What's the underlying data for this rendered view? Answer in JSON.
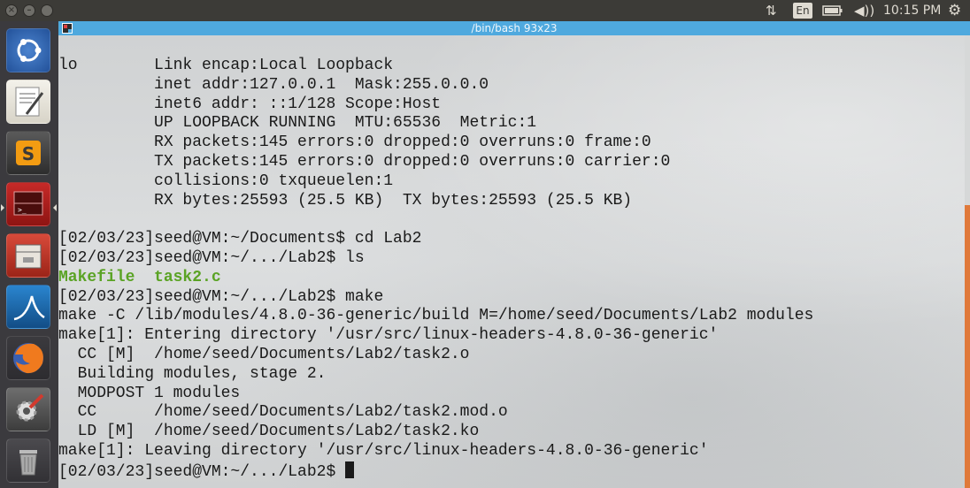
{
  "panel": {
    "clock": "10:15 PM",
    "language": "En"
  },
  "terminal": {
    "title": "/bin/bash 93x23",
    "lines": [
      "",
      "lo        Link encap:Local Loopback",
      "          inet addr:127.0.0.1  Mask:255.0.0.0",
      "          inet6 addr: ::1/128 Scope:Host",
      "          UP LOOPBACK RUNNING  MTU:65536  Metric:1",
      "          RX packets:145 errors:0 dropped:0 overruns:0 frame:0",
      "          TX packets:145 errors:0 dropped:0 overruns:0 carrier:0",
      "          collisions:0 txqueuelen:1",
      "          RX bytes:25593 (25.5 KB)  TX bytes:25593 (25.5 KB)",
      "",
      "[02/03/23]seed@VM:~/Documents$ cd Lab2",
      "[02/03/23]seed@VM:~/.../Lab2$ ls"
    ],
    "ls_output": "Makefile  task2.c",
    "lines_after": [
      "[02/03/23]seed@VM:~/.../Lab2$ make",
      "make -C /lib/modules/4.8.0-36-generic/build M=/home/seed/Documents/Lab2 modules",
      "make[1]: Entering directory '/usr/src/linux-headers-4.8.0-36-generic'",
      "  CC [M]  /home/seed/Documents/Lab2/task2.o",
      "  Building modules, stage 2.",
      "  MODPOST 1 modules",
      "  CC      /home/seed/Documents/Lab2/task2.mod.o",
      "  LD [M]  /home/seed/Documents/Lab2/task2.ko",
      "make[1]: Leaving directory '/usr/src/linux-headers-4.8.0-36-generic'"
    ],
    "prompt": "[02/03/23]seed@VM:~/.../Lab2$ "
  },
  "launcher": [
    {
      "name": "ubuntu-dash-icon",
      "color": "#3b6fb6"
    },
    {
      "name": "text-editor-icon",
      "color": "#e9e6df"
    },
    {
      "name": "sublime-text-icon",
      "color": "#4a4a4a"
    },
    {
      "name": "terminal-icon",
      "color": "#b0201e"
    },
    {
      "name": "file-manager-icon",
      "color": "#c0392b"
    },
    {
      "name": "wireshark-icon",
      "color": "#1f6fb2"
    },
    {
      "name": "firefox-icon",
      "color": "#e86b1f"
    },
    {
      "name": "system-settings-icon",
      "color": "#5c5c5c"
    },
    {
      "name": "trash-icon",
      "color": "#7b7b7b"
    }
  ]
}
